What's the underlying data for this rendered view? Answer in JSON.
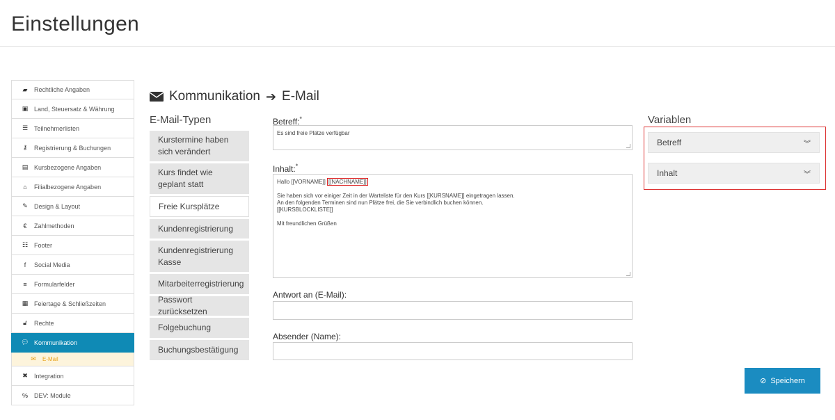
{
  "page": {
    "title": "Einstellungen"
  },
  "sidebar": {
    "items": [
      {
        "label": "Rechtliche Angaben",
        "icon": "book-icon"
      },
      {
        "label": "Land, Steuersatz & Währung",
        "icon": "money-icon"
      },
      {
        "label": "Teilnehmerlisten",
        "icon": "list-icon"
      },
      {
        "label": "Registrierung & Buchungen",
        "icon": "key-icon"
      },
      {
        "label": "Kursbezogene Angaben",
        "icon": "card-icon"
      },
      {
        "label": "Filialbezogene Angaben",
        "icon": "home-icon"
      },
      {
        "label": "Design & Layout",
        "icon": "brush-icon"
      },
      {
        "label": "Zahlmethoden",
        "icon": "euro-icon"
      },
      {
        "label": "Footer",
        "icon": "footer-icon"
      },
      {
        "label": "Social Media",
        "icon": "facebook-icon"
      },
      {
        "label": "Formularfelder",
        "icon": "form-icon"
      },
      {
        "label": "Feiertage & Schließzeiten",
        "icon": "calendar-icon"
      },
      {
        "label": "Rechte",
        "icon": "unlock-icon"
      },
      {
        "label": "Kommunikation",
        "icon": "comments-icon",
        "active": true
      },
      {
        "label": "E-Mail",
        "icon": "envelope-icon",
        "sub": true
      },
      {
        "label": "Integration",
        "icon": "puzzle-icon"
      },
      {
        "label": "DEV: Module",
        "icon": "link-icon"
      }
    ]
  },
  "section": {
    "title": "Kommunikation",
    "subtitle": "E-Mail"
  },
  "types": {
    "title": "E-Mail-Typen",
    "items": [
      "Kurstermine haben sich verändert",
      "Kurs findet wie geplant statt",
      "Freie Kursplätze",
      "Kundenregistrierung",
      "Kundenregistrierung Kasse",
      "Mitarbeiterregistrierung",
      "Passwort zurücksetzen",
      "Folgebuchung",
      "Buchungsbestätigung"
    ],
    "active_index": 2
  },
  "form": {
    "subject_label": "Betreff:",
    "subject_value": "Es sind freie Plätze verfügbar",
    "content_label": "Inhalt:",
    "content_greeting": "Hallo [[VORNAME]] ",
    "content_lastname_tag": "[[NACHNAME]]",
    "content_lines": [
      "Sie haben sich vor einiger Zeit in der Warteliste für den Kurs [[KURSNAME]] eingetragen lassen.",
      "An den folgenden Terminen sind nun Plätze frei, die Sie verbindlich buchen können.",
      "[[KURSBLOCKLISTE]]",
      "",
      "Mit freundlichen Grüßen"
    ],
    "reply_label": "Antwort an (E-Mail):",
    "reply_value": "",
    "sender_label": "Absender (Name):",
    "sender_value": "",
    "required_mark": "*"
  },
  "variables": {
    "title": "Variablen",
    "items": [
      "Betreff",
      "Inhalt"
    ]
  },
  "save_button": {
    "label": "Speichern"
  },
  "colors": {
    "accent": "#0f8ab5",
    "button": "#1b8cc1",
    "highlight": "#dd2222",
    "sub_active": "#e8a21b"
  }
}
